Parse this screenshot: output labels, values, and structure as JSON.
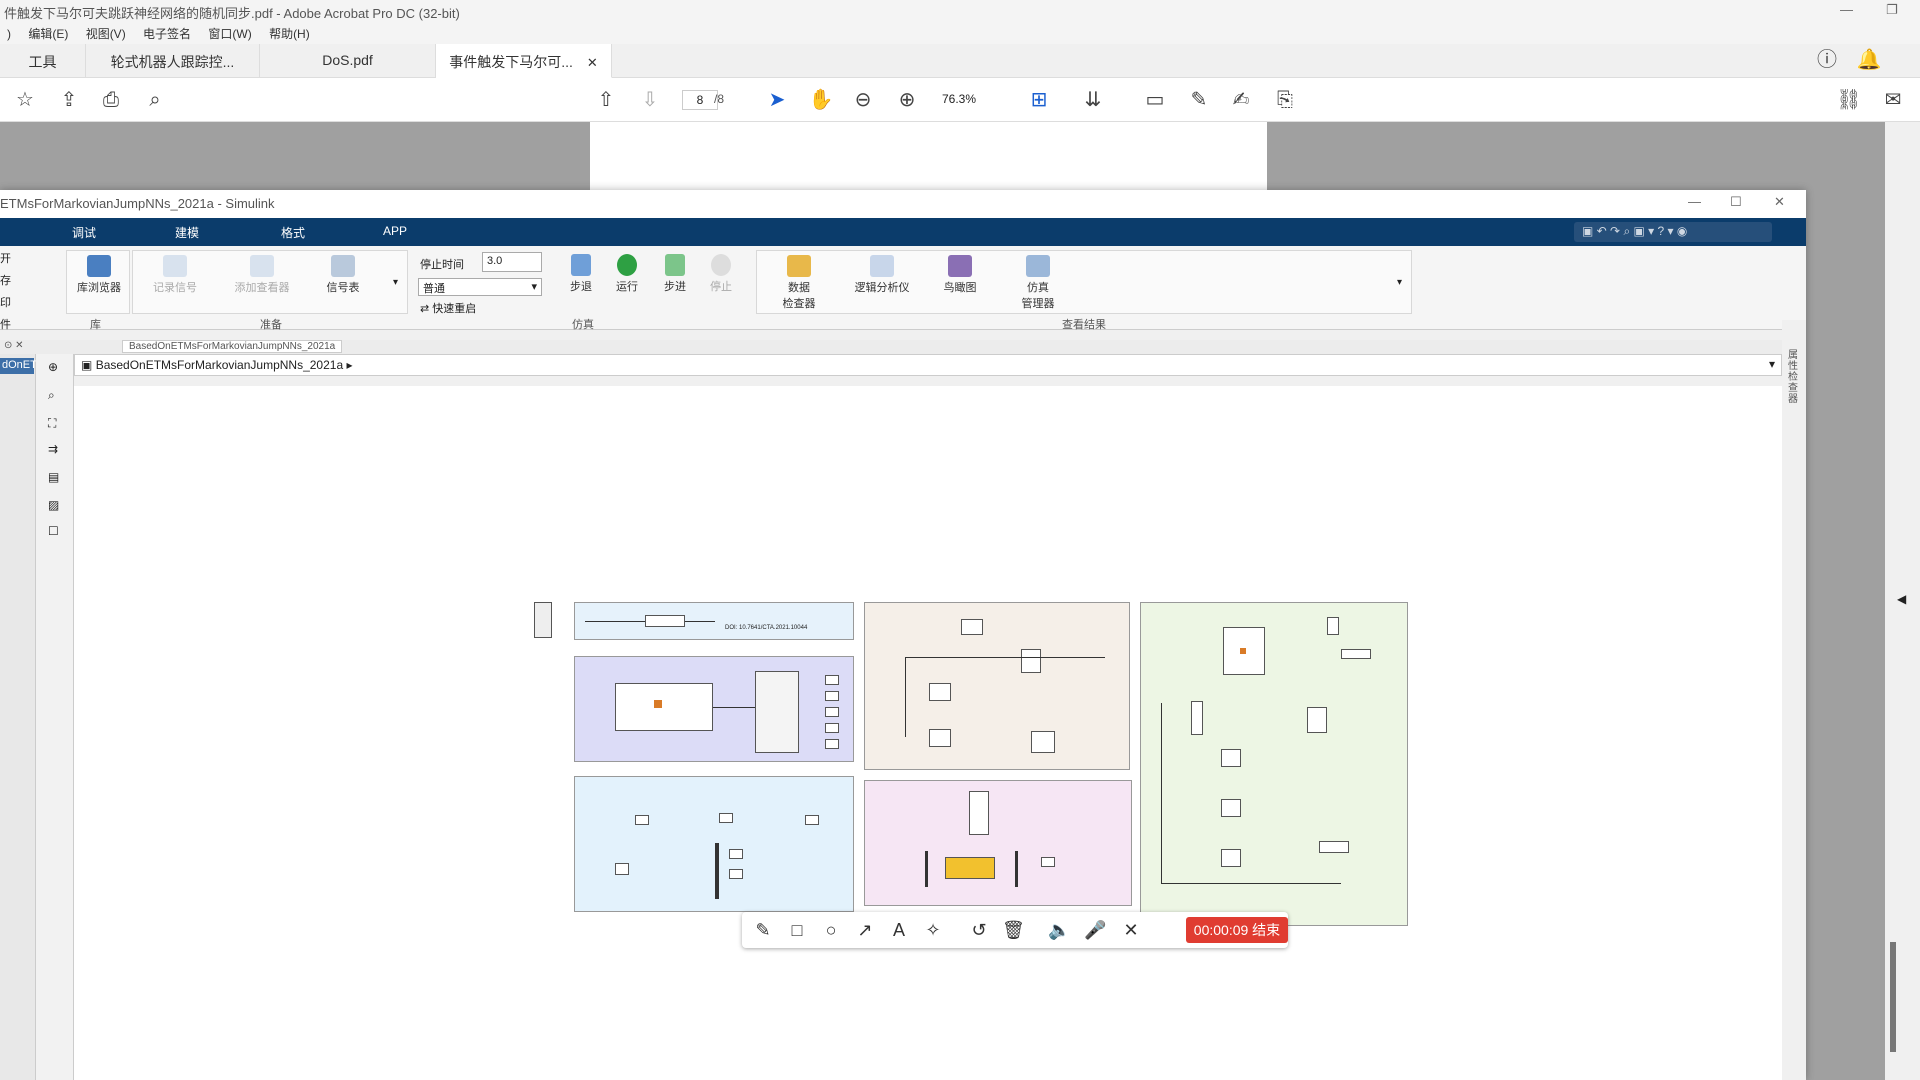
{
  "acrobat": {
    "title": "件触发下马尔可夫跳跃神经网络的随机同步.pdf - Adobe Acrobat Pro DC (32-bit)",
    "menu": [
      ")",
      "编辑(E)",
      "视图(V)",
      "电子签名",
      "窗口(W)",
      "帮助(H)"
    ],
    "tabs": [
      "工具",
      "轮式机器人跟踪控...",
      "DoS.pdf",
      "事件触发下马尔可..."
    ],
    "page_current": "8",
    "page_total": "/8",
    "zoom": "76.3%",
    "icons": [
      "star-icon",
      "upload-icon",
      "print-icon",
      "zoom-out-icon",
      "page-up-icon",
      "page-down-icon",
      "select-arrow-icon",
      "hand-icon",
      "minus-icon",
      "plus-icon",
      "fit-icon",
      "scroll-icon",
      "comment-icon",
      "highlight-icon",
      "sign-icon",
      "stamp-icon",
      "help-icon",
      "bell-icon",
      "share-icon",
      "mail-icon"
    ]
  },
  "simulink": {
    "title": "ETMsForMarkovianJumpNNs_2021a - Simulink",
    "ribbon_tabs": [
      "调试",
      "建模",
      "格式",
      "APP"
    ],
    "left_menu": [
      "开",
      "存",
      "印",
      "件"
    ],
    "library": {
      "browser": "库浏览器",
      "group": "库"
    },
    "prepare": {
      "record": "记录信号",
      "add_viewer": "添加查看器",
      "signal_table": "信号表",
      "group": "准备"
    },
    "simulate": {
      "stop_time_label": "停止时间",
      "stop_time": "3.0",
      "mode": "普通",
      "fast_restart": "快速重启",
      "step_back": "步退",
      "run": "运行",
      "step_forward": "步进",
      "stop": "停止",
      "group": "仿真"
    },
    "results": {
      "data_inspector": "数据\n检查器",
      "logic_analyzer": "逻辑分析仪",
      "birdseye": "鸟瞰图",
      "sim_manager": "仿真\n管理器",
      "group": "查看结果"
    },
    "breadcrumb_tab": "BasedOnETMsForMarkovianJumpNNs_2021a",
    "address": "BasedOnETMsForMarkovianJumpNNs_2021a",
    "model_tag": "dOnET",
    "property_inspector": "属性检查器",
    "model_note": "DOI: 10.7641/CTA.2021.10044"
  },
  "recorder": {
    "icons": [
      "pen-icon",
      "rectangle-icon",
      "circle-icon",
      "arrow-icon",
      "text-icon",
      "magic-icon",
      "undo-icon",
      "trash-icon",
      "speaker-icon",
      "mic-icon",
      "close-icon"
    ],
    "end_label": "00:00:09 结束"
  },
  "colors": {
    "ribbon_blue": "#0b3c6b",
    "rec_red": "#e03c31"
  }
}
